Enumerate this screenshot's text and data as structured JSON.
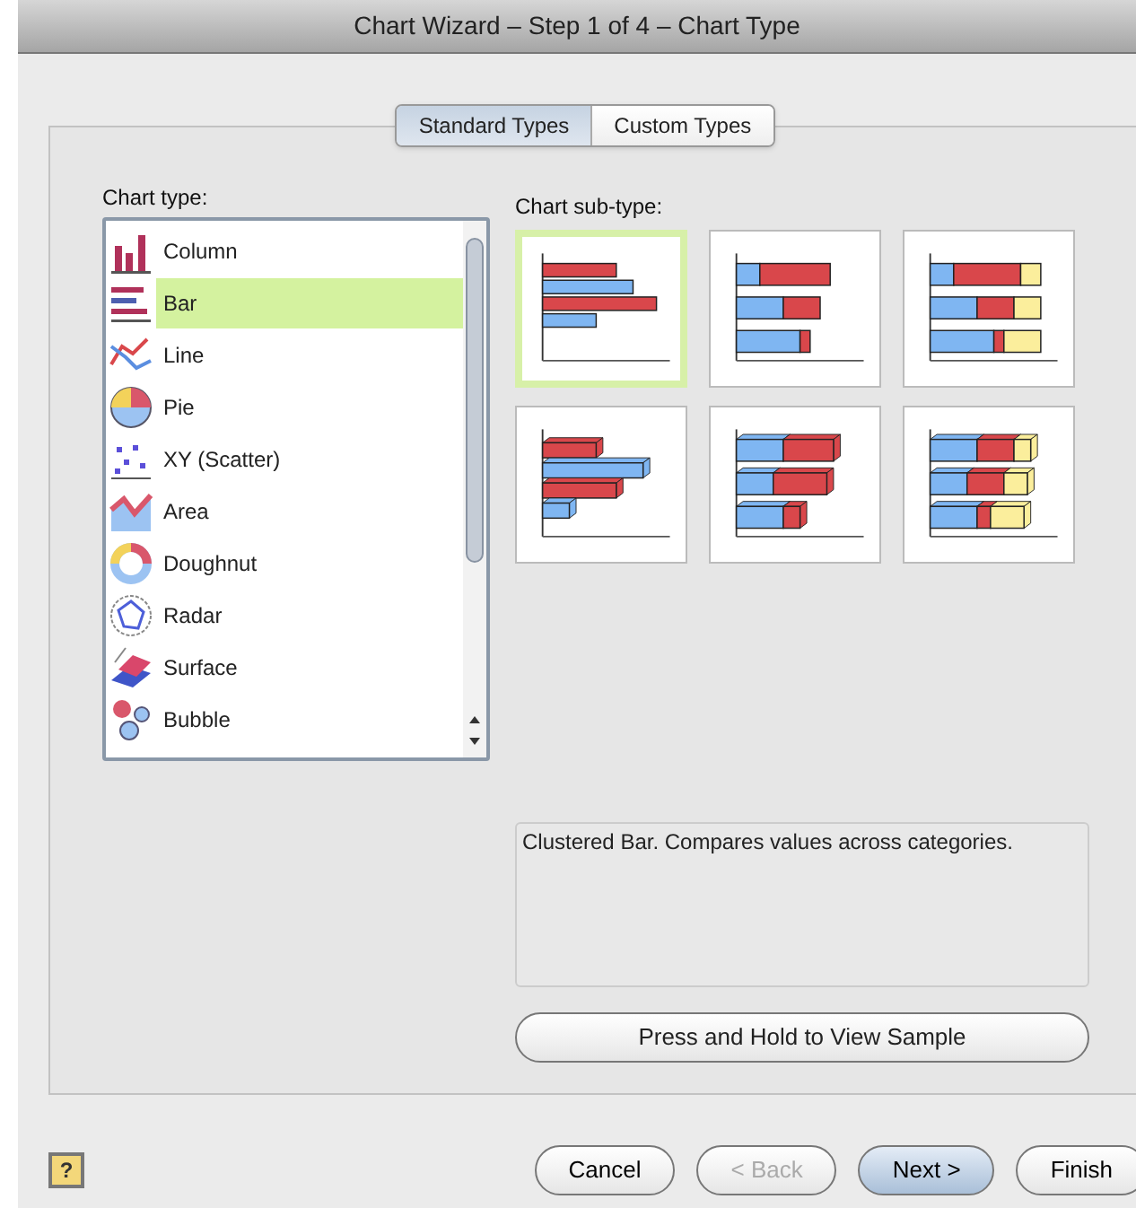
{
  "window": {
    "title": "Chart Wizard – Step 1 of 4 – Chart Type"
  },
  "tabs": [
    {
      "label": "Standard Types",
      "selected": true
    },
    {
      "label": "Custom Types",
      "selected": false
    }
  ],
  "chart_type": {
    "label": "Chart type:",
    "items": [
      {
        "label": "Column",
        "kind": "column",
        "selected": false
      },
      {
        "label": "Bar",
        "kind": "bar",
        "selected": true
      },
      {
        "label": "Line",
        "kind": "line",
        "selected": false
      },
      {
        "label": "Pie",
        "kind": "pie",
        "selected": false
      },
      {
        "label": "XY (Scatter)",
        "kind": "scatter",
        "selected": false
      },
      {
        "label": "Area",
        "kind": "area",
        "selected": false
      },
      {
        "label": "Doughnut",
        "kind": "doughnut",
        "selected": false
      },
      {
        "label": "Radar",
        "kind": "radar",
        "selected": false
      },
      {
        "label": "Surface",
        "kind": "surface",
        "selected": false
      },
      {
        "label": "Bubble",
        "kind": "bubble",
        "selected": false
      }
    ]
  },
  "sub_type": {
    "label": "Chart sub-type:",
    "items": [
      {
        "kind": "clustered",
        "selected": true
      },
      {
        "kind": "stacked",
        "selected": false
      },
      {
        "kind": "stacked100",
        "selected": false
      },
      {
        "kind": "clustered3d",
        "selected": false
      },
      {
        "kind": "stacked3d",
        "selected": false
      },
      {
        "kind": "stacked100_3d",
        "selected": false
      }
    ]
  },
  "description": "Clustered Bar. Compares values across categories.",
  "sample_button": "Press and Hold to View Sample",
  "help_button": "?",
  "buttons": [
    {
      "label": "Cancel",
      "kind": "normal",
      "disabled": false
    },
    {
      "label": "< Back",
      "kind": "normal",
      "disabled": true
    },
    {
      "label": "Next >",
      "kind": "default",
      "disabled": false
    },
    {
      "label": "Finish",
      "kind": "normal",
      "disabled": false
    }
  ]
}
